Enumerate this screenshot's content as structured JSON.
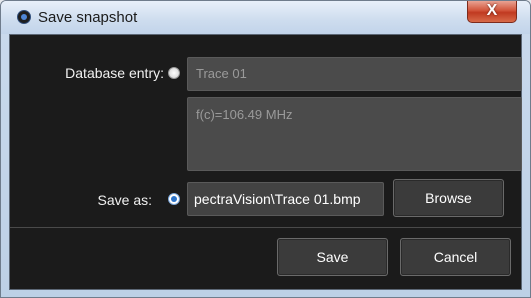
{
  "window": {
    "title": "Save snapshot",
    "close_glyph": "X"
  },
  "form": {
    "database_entry": {
      "label": "Database entry:",
      "selected": false,
      "name_value": "Trace 01",
      "description_value": "f(c)=106.49 MHz"
    },
    "save_as": {
      "label": "Save as:",
      "selected": true,
      "path_value": "pectraVision\\Trace 01.bmp",
      "browse_label": "Browse"
    }
  },
  "footer": {
    "save_label": "Save",
    "cancel_label": "Cancel"
  },
  "icons": {
    "app": "app-icon",
    "close": "close-icon"
  },
  "colors": {
    "dialog_background": "#1b1b1b",
    "field_background": "#4b4b4b",
    "radio_selected": "#2b73c9",
    "close_button": "#c8442a"
  }
}
